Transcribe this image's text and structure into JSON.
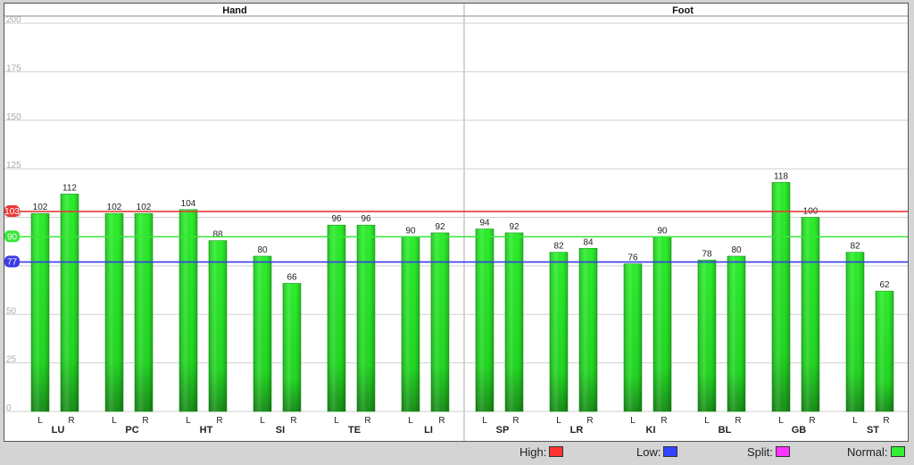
{
  "chart_data": {
    "type": "bar",
    "groups": [
      "Hand",
      "Foot"
    ],
    "categories": [
      "LU",
      "PC",
      "HT",
      "SI",
      "TE",
      "LI",
      "SP",
      "LR",
      "KI",
      "BL",
      "GB",
      "ST"
    ],
    "category_group": [
      "Hand",
      "Hand",
      "Hand",
      "Hand",
      "Hand",
      "Hand",
      "Foot",
      "Foot",
      "Foot",
      "Foot",
      "Foot",
      "Foot"
    ],
    "sub_labels": [
      "L",
      "R"
    ],
    "series": [
      {
        "name": "L",
        "values": [
          102,
          102,
          104,
          80,
          96,
          90,
          94,
          82,
          76,
          78,
          118,
          82
        ]
      },
      {
        "name": "R",
        "values": [
          112,
          102,
          88,
          66,
          96,
          92,
          92,
          84,
          90,
          80,
          100,
          62
        ]
      }
    ],
    "ylim": [
      0,
      200
    ],
    "yticks": [
      0,
      25,
      50,
      75,
      100,
      125,
      150,
      175,
      200
    ],
    "grid": true,
    "bar_color": "#22dd22",
    "reference_lines": [
      {
        "name": "High",
        "value": 103,
        "label": "103",
        "color": "#e83a3a"
      },
      {
        "name": "Normal",
        "value": 90,
        "label": "90",
        "color": "#39e639"
      },
      {
        "name": "Low",
        "value": 77,
        "label": "77",
        "color": "#3a3ae8"
      }
    ],
    "legend": [
      {
        "label": "High:",
        "color": "#ff3333"
      },
      {
        "label": "Low:",
        "color": "#3344ff"
      },
      {
        "label": "Split:",
        "color": "#ff33ff"
      },
      {
        "label": "Normal:",
        "color": "#33ee33"
      }
    ],
    "legend_position": "bottom-right"
  }
}
